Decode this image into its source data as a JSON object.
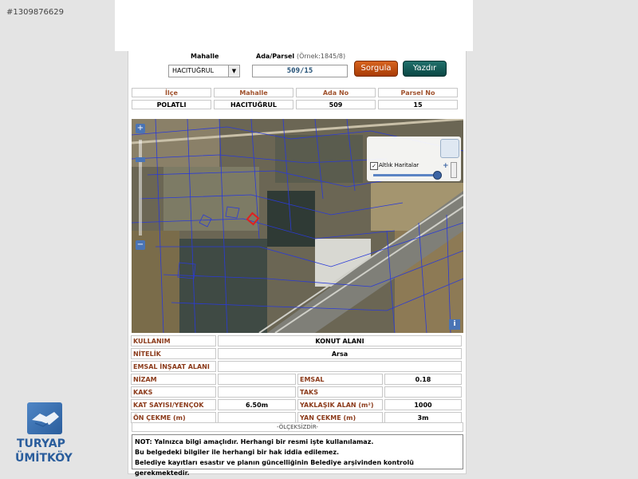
{
  "listing_id": "#1309876629",
  "search": {
    "mahalle_label": "Mahalle",
    "ada_parsel_label": "Ada/Parsel",
    "ada_parsel_hint": "(Örnek:1845/8)",
    "mahalle_selected": "HACITUĞRUL",
    "ada_parsel_value": "509/15",
    "query_button": "Sorgula",
    "print_button": "Yazdır"
  },
  "summary": {
    "headers": [
      "İlçe",
      "Mahalle",
      "Ada No",
      "Parsel No"
    ],
    "values": [
      "POLATLI",
      "HACITUĞRUL",
      "509",
      "15"
    ]
  },
  "map": {
    "zoom_in": "+",
    "zoom_out": "−",
    "layer_label": "Altlık Haritalar",
    "layer_checked": "✓",
    "layer_plus": "+",
    "info": "i",
    "highlight_color": "#e02020",
    "parcel_line_color": "#2a3ad8"
  },
  "details": {
    "kullanim_label": "KULLANIM",
    "kullanim_value": "KONUT ALANI",
    "nitelik_label": "NİTELİK",
    "nitelik_value": "Arsa",
    "emsal_insaat_label": "EMSAL İNŞAAT ALANI",
    "emsal_insaat_value": "",
    "nizam_label": "NİZAM",
    "nizam_value": "",
    "emsal_label": "EMSAL",
    "emsal_value": "0.18",
    "kaks_label": "KAKS",
    "kaks_value": "",
    "taks_label": "TAKS",
    "taks_value": "",
    "kat_label": "KAT SAYISI/YENÇOK",
    "kat_value": "6.50m",
    "alan_label": "YAKLAŞIK ALAN (m²)",
    "alan_value": "1000",
    "on_cekme_label": "ÖN ÇEKME (m)",
    "on_cekme_value": "",
    "yan_cekme_label": "YAN ÇEKME (m)",
    "yan_cekme_value": "3m"
  },
  "scale_text": "-ÖLÇEKSİZDİR-",
  "notes": [
    "NOT: Yalnızca bilgi amaçlıdır. Herhangi bir resmi işte kullanılamaz.",
    "Bu belgedeki bilgiler ile herhangi bir hak iddia edilemez.",
    "Belediye kayıtları esastır ve planın güncelliğinin Belediye arşivinden kontrolü gerekmektedir."
  ],
  "logo": {
    "line1": "TURYAP",
    "line2": "ÜMİTKÖY"
  }
}
